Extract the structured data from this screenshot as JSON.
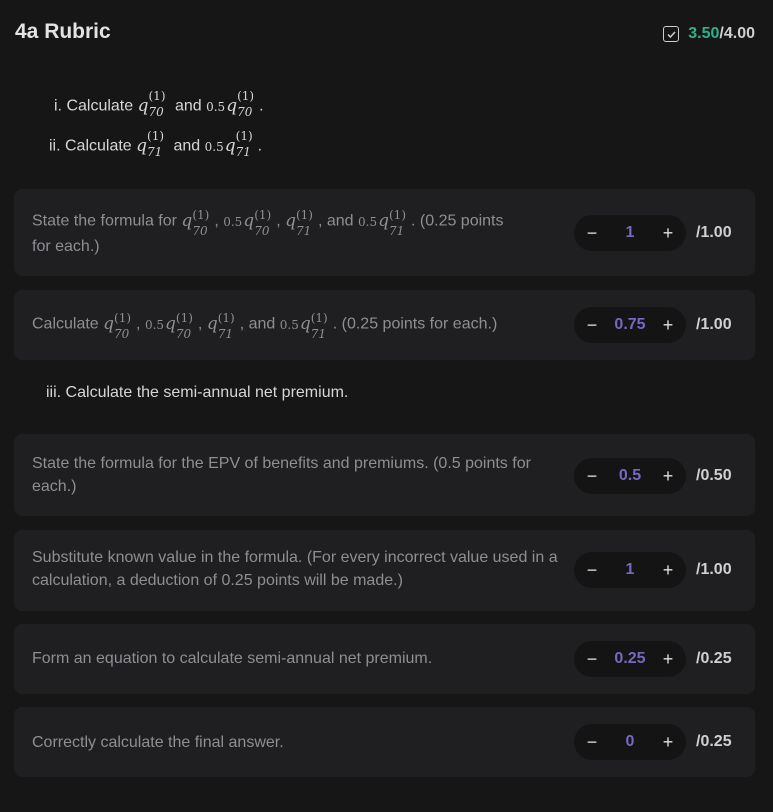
{
  "header": {
    "title": "4a Rubric",
    "score_earned": "3.50",
    "score_total": "/4.00"
  },
  "questions": {
    "i": {
      "prefix": "i. Calculate",
      "mid": "and",
      "end": "."
    },
    "ii": {
      "prefix": "ii. Calculate",
      "mid": "and",
      "end": "."
    },
    "iii": "iii. Calculate the semi-annual net premium."
  },
  "rubric_items": [
    {
      "text_a": "State the formula for",
      "text_b": ". (0.25 points",
      "text_c": "for each.)",
      "value": "1",
      "max": "/1.00"
    },
    {
      "text_a": "Calculate",
      "text_b": ". (0.25 points for each.)",
      "value": "0.75",
      "max": "/1.00"
    },
    {
      "text": "State the formula for the EPV of benefits and premiums. (0.5 points for each.)",
      "value": "0.5",
      "max": "/0.50"
    },
    {
      "text": "Substitute known value in the formula. (For every incorrect value used in a calculation, a deduction of 0.25 points will be made.)",
      "value": "1",
      "max": "/1.00"
    },
    {
      "text": "Form an equation to calculate semi-annual net premium.",
      "value": "0.25",
      "max": "/0.25"
    },
    {
      "text": "Correctly calculate the final answer.",
      "value": "0",
      "max": "/0.25"
    }
  ],
  "math": {
    "sup": "(1)",
    "sub70": "70",
    "sub71": "71",
    "q": "q",
    "half": "0.5",
    "and": "and",
    "comma": ", "
  },
  "controls": {
    "minus": "−",
    "plus": "+"
  },
  "colors": {
    "accent_green": "#2bb38a",
    "value_purple": "#7668c3"
  },
  "icons": {
    "score": "checkbox-check-icon"
  }
}
